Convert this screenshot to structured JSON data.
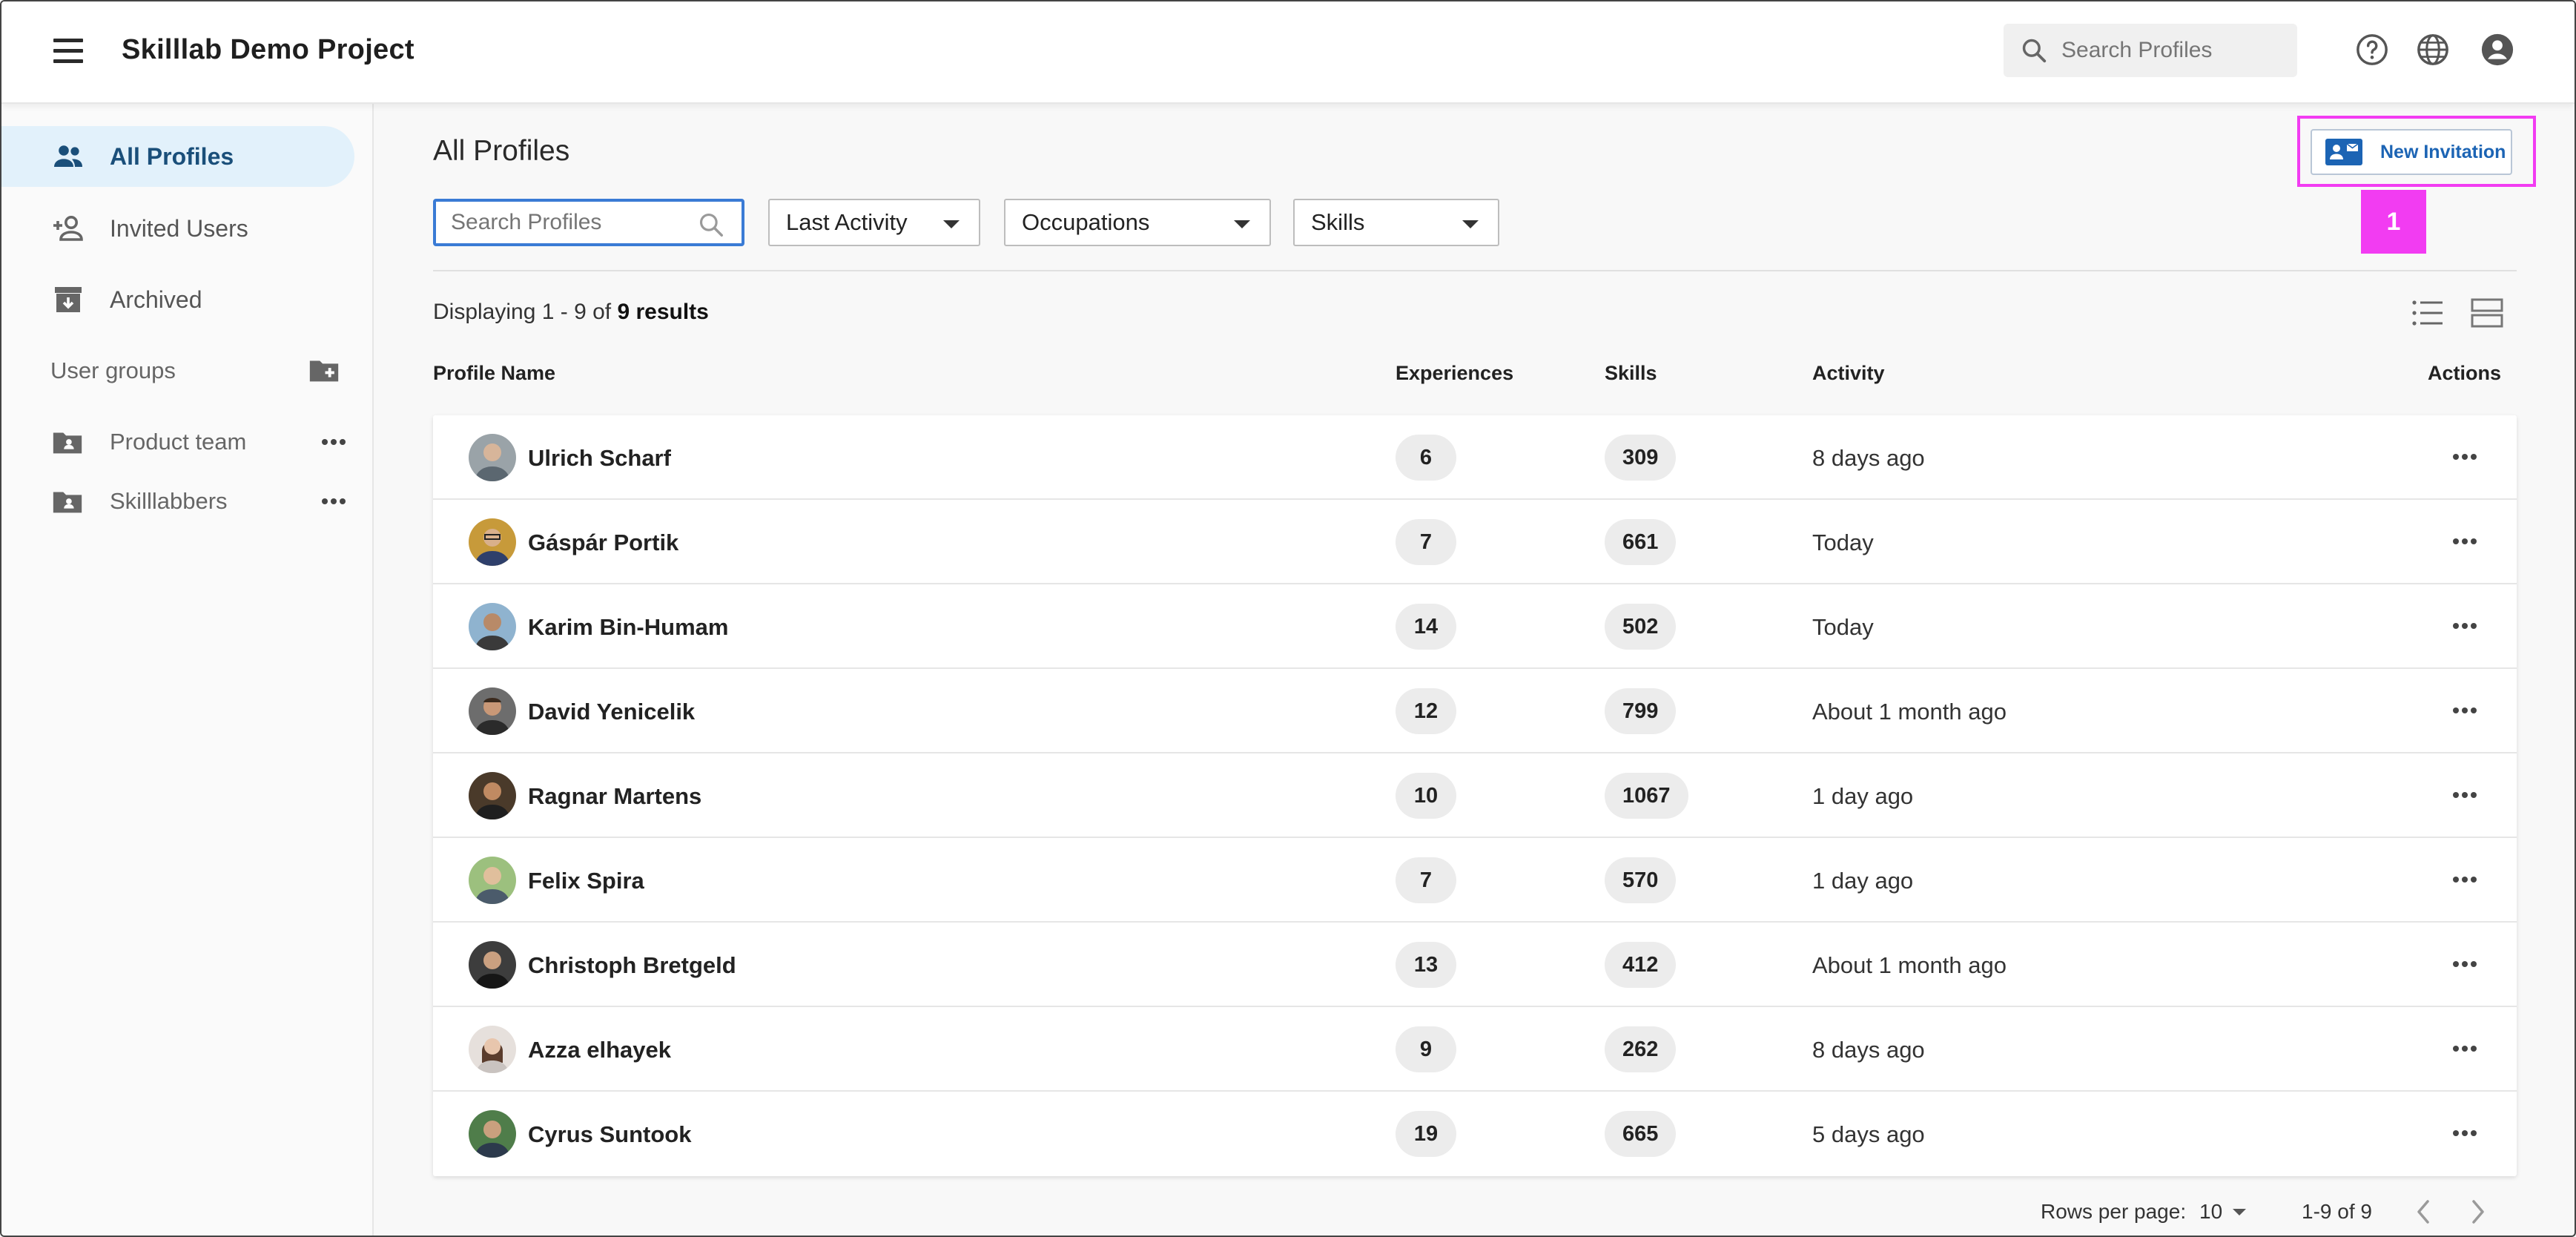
{
  "app": {
    "title": "Skilllab Demo Project",
    "search_placeholder": "Search Profiles"
  },
  "sidebar": {
    "items": [
      {
        "label": "All Profiles",
        "icon": "people-icon",
        "active": true
      },
      {
        "label": "Invited Users",
        "icon": "person-add-icon",
        "active": false
      },
      {
        "label": "Archived",
        "icon": "archive-icon",
        "active": false
      }
    ],
    "groups_header": "User groups",
    "groups": [
      {
        "label": "Product team",
        "icon": "folder-shared-icon"
      },
      {
        "label": "Skilllabbers",
        "icon": "folder-shared-icon"
      }
    ]
  },
  "main": {
    "title": "All Profiles",
    "search_placeholder": "Search Profiles",
    "filters": {
      "sort": "Last Activity",
      "occupations": "Occupations",
      "skills": "Skills"
    },
    "new_invitation_label": "New Invitation",
    "callout_number": "1",
    "results_prefix": "Displaying 1 - 9 of ",
    "results_count": "9 results",
    "columns": {
      "name": "Profile Name",
      "experiences": "Experiences",
      "skills": "Skills",
      "activity": "Activity",
      "actions": "Actions"
    },
    "rows": [
      {
        "name": "Ulrich Scharf",
        "experiences": "6",
        "skills": "309",
        "activity": "8 days ago"
      },
      {
        "name": "Gáspár Portik",
        "experiences": "7",
        "skills": "661",
        "activity": "Today"
      },
      {
        "name": "Karim Bin-Humam",
        "experiences": "14",
        "skills": "502",
        "activity": "Today"
      },
      {
        "name": "David Yenicelik",
        "experiences": "12",
        "skills": "799",
        "activity": "About 1 month ago"
      },
      {
        "name": "Ragnar Martens",
        "experiences": "10",
        "skills": "1067",
        "activity": "1 day ago"
      },
      {
        "name": "Felix Spira",
        "experiences": "7",
        "skills": "570",
        "activity": "1 day ago"
      },
      {
        "name": "Christoph Bretgeld",
        "experiences": "13",
        "skills": "412",
        "activity": "About 1 month ago"
      },
      {
        "name": "Azza elhayek",
        "experiences": "9",
        "skills": "262",
        "activity": "8 days ago"
      },
      {
        "name": "Cyrus Suntook",
        "experiences": "19",
        "skills": "665",
        "activity": "5 days ago"
      }
    ],
    "pagination": {
      "rows_per_page_label": "Rows per page:",
      "rows_per_page": "10",
      "range": "1-9 of 9"
    }
  },
  "colors": {
    "accent": "#1c64b4",
    "active_nav_bg": "#e2f1fb",
    "callout": "#f23cf2",
    "search_border": "#3a7bd5"
  }
}
